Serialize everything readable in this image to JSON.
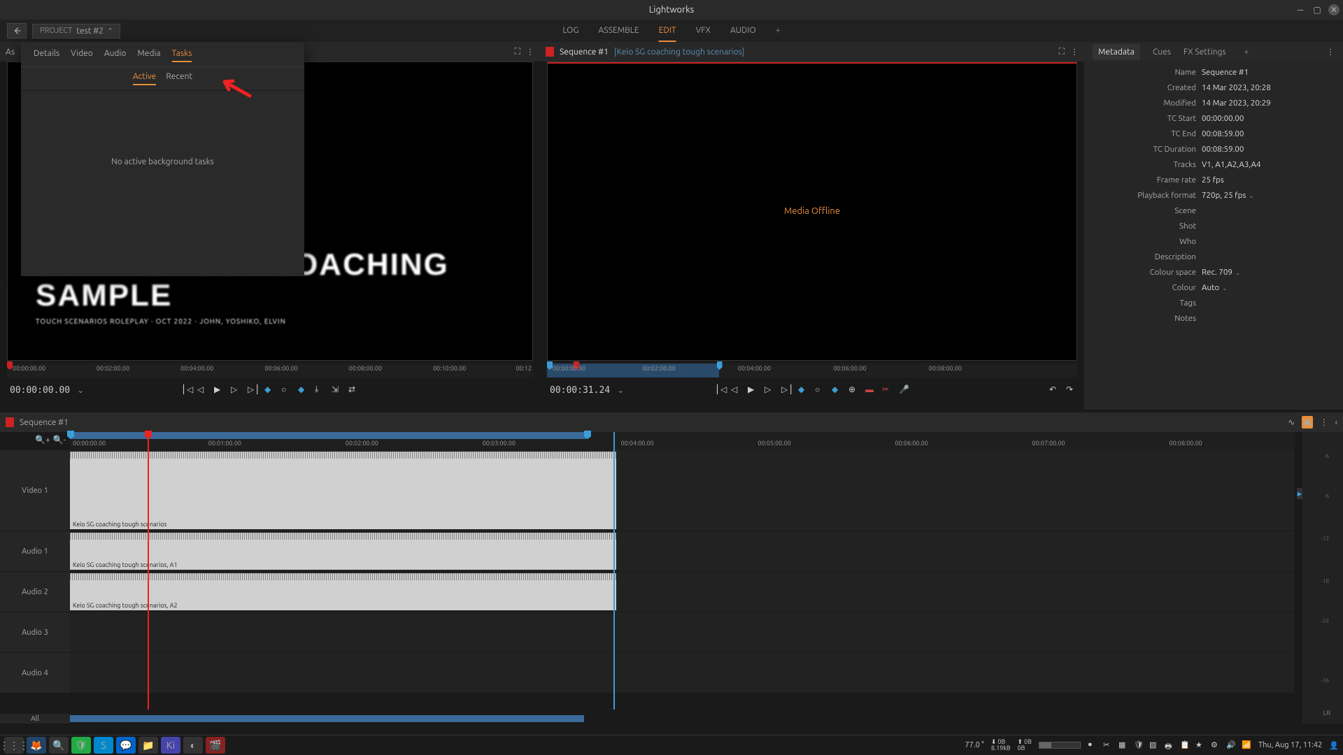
{
  "app_title": "Lightworks",
  "project": {
    "label": "PROJECT",
    "name": "test #2"
  },
  "nav": [
    "LOG",
    "ASSEMBLE",
    "EDIT",
    "VFX",
    "AUDIO"
  ],
  "nav_active": "EDIT",
  "viewer_left": {
    "asset_label_truncated": "As",
    "title_main": "SKILL GROUP COACHING\nSAMPLE",
    "title_sub": "TOUCH SCENARIOS ROLEPLAY · OCT 2022 · JOHN, YOSHIKO, ELVIN",
    "ruler": [
      "00:00:00.00",
      "00:02:00.00",
      "00:04:00.00",
      "00:06:00.00",
      "00:08:00.00",
      "00:10:00.00",
      "00:12"
    ],
    "timecode": "00:00:00.00"
  },
  "viewer_right": {
    "sequence": "Sequence #1",
    "clip": "[Keio SG coaching tough scenarios]",
    "media_offline": "Media Offline",
    "ruler": [
      "00:00:00.00",
      "00:02:00.00",
      "00:04:00.00",
      "00:06:00.00",
      "00:08:00.00"
    ],
    "timecode": "00:00:31.24"
  },
  "popup": {
    "tabs": [
      "Details",
      "Video",
      "Audio",
      "Media",
      "Tasks"
    ],
    "tabs_active": "Tasks",
    "subtabs": [
      "Active",
      "Recent"
    ],
    "subtabs_active": "Active",
    "message": "No active background tasks"
  },
  "metadata": {
    "tabs": [
      "Metadata",
      "Cues",
      "FX Settings"
    ],
    "tabs_active": "Metadata",
    "rows": [
      {
        "k": "Name",
        "v": "Sequence #1"
      },
      {
        "k": "Created",
        "v": "14 Mar 2023, 20:28"
      },
      {
        "k": "Modified",
        "v": "14 Mar 2023, 20:29"
      },
      {
        "k": "TC Start",
        "v": "00:00:00.00"
      },
      {
        "k": "TC End",
        "v": "00:08:59.00"
      },
      {
        "k": "TC Duration",
        "v": "00:08:59.00"
      },
      {
        "k": "Tracks",
        "v": "V1, A1,A2,A3,A4"
      },
      {
        "k": "Frame rate",
        "v": "25 fps"
      },
      {
        "k": "Playback format",
        "v": "720p, 25 fps",
        "chev": true
      },
      {
        "k": "Scene",
        "v": ""
      },
      {
        "k": "Shot",
        "v": ""
      },
      {
        "k": "Who",
        "v": ""
      },
      {
        "k": "Description",
        "v": ""
      },
      {
        "k": "Colour space",
        "v": "Rec. 709",
        "chev": true
      },
      {
        "k": "Colour",
        "v": "Auto",
        "chev": true
      },
      {
        "k": "Tags",
        "v": ""
      },
      {
        "k": "Notes",
        "v": ""
      }
    ]
  },
  "timeline": {
    "header": "Sequence #1",
    "ruler": [
      "00:00:00.00",
      "00:01:00.00",
      "00:02:00.00",
      "00:03:00.00",
      "00:04:00.00",
      "00:05:00.00",
      "00:06:00.00",
      "00:07:00.00",
      "00:08:00.00"
    ],
    "tracks": [
      {
        "name": "Video 1",
        "type": "video",
        "clip": "Keio SG coaching tough scenarios"
      },
      {
        "name": "Audio 1",
        "type": "audio",
        "clip": "Keio SG coaching tough scenarios, A1"
      },
      {
        "name": "Audio 2",
        "type": "audio",
        "clip": "Keio SG coaching tough scenarios, A2"
      },
      {
        "name": "Audio 3",
        "type": "audio",
        "clip": ""
      },
      {
        "name": "Audio 4",
        "type": "audio",
        "clip": ""
      }
    ],
    "all_label": "All"
  },
  "meter": {
    "ticks": [
      "-6",
      "-6",
      "-12",
      "-18",
      "-24",
      "-36"
    ],
    "lr": "LR"
  },
  "taskbar": {
    "temp": "77.0 °",
    "net_down": "0B\n8.19kB",
    "net_up": "0B\n0B",
    "datetime": "Thu, Aug 17, 11:42"
  }
}
